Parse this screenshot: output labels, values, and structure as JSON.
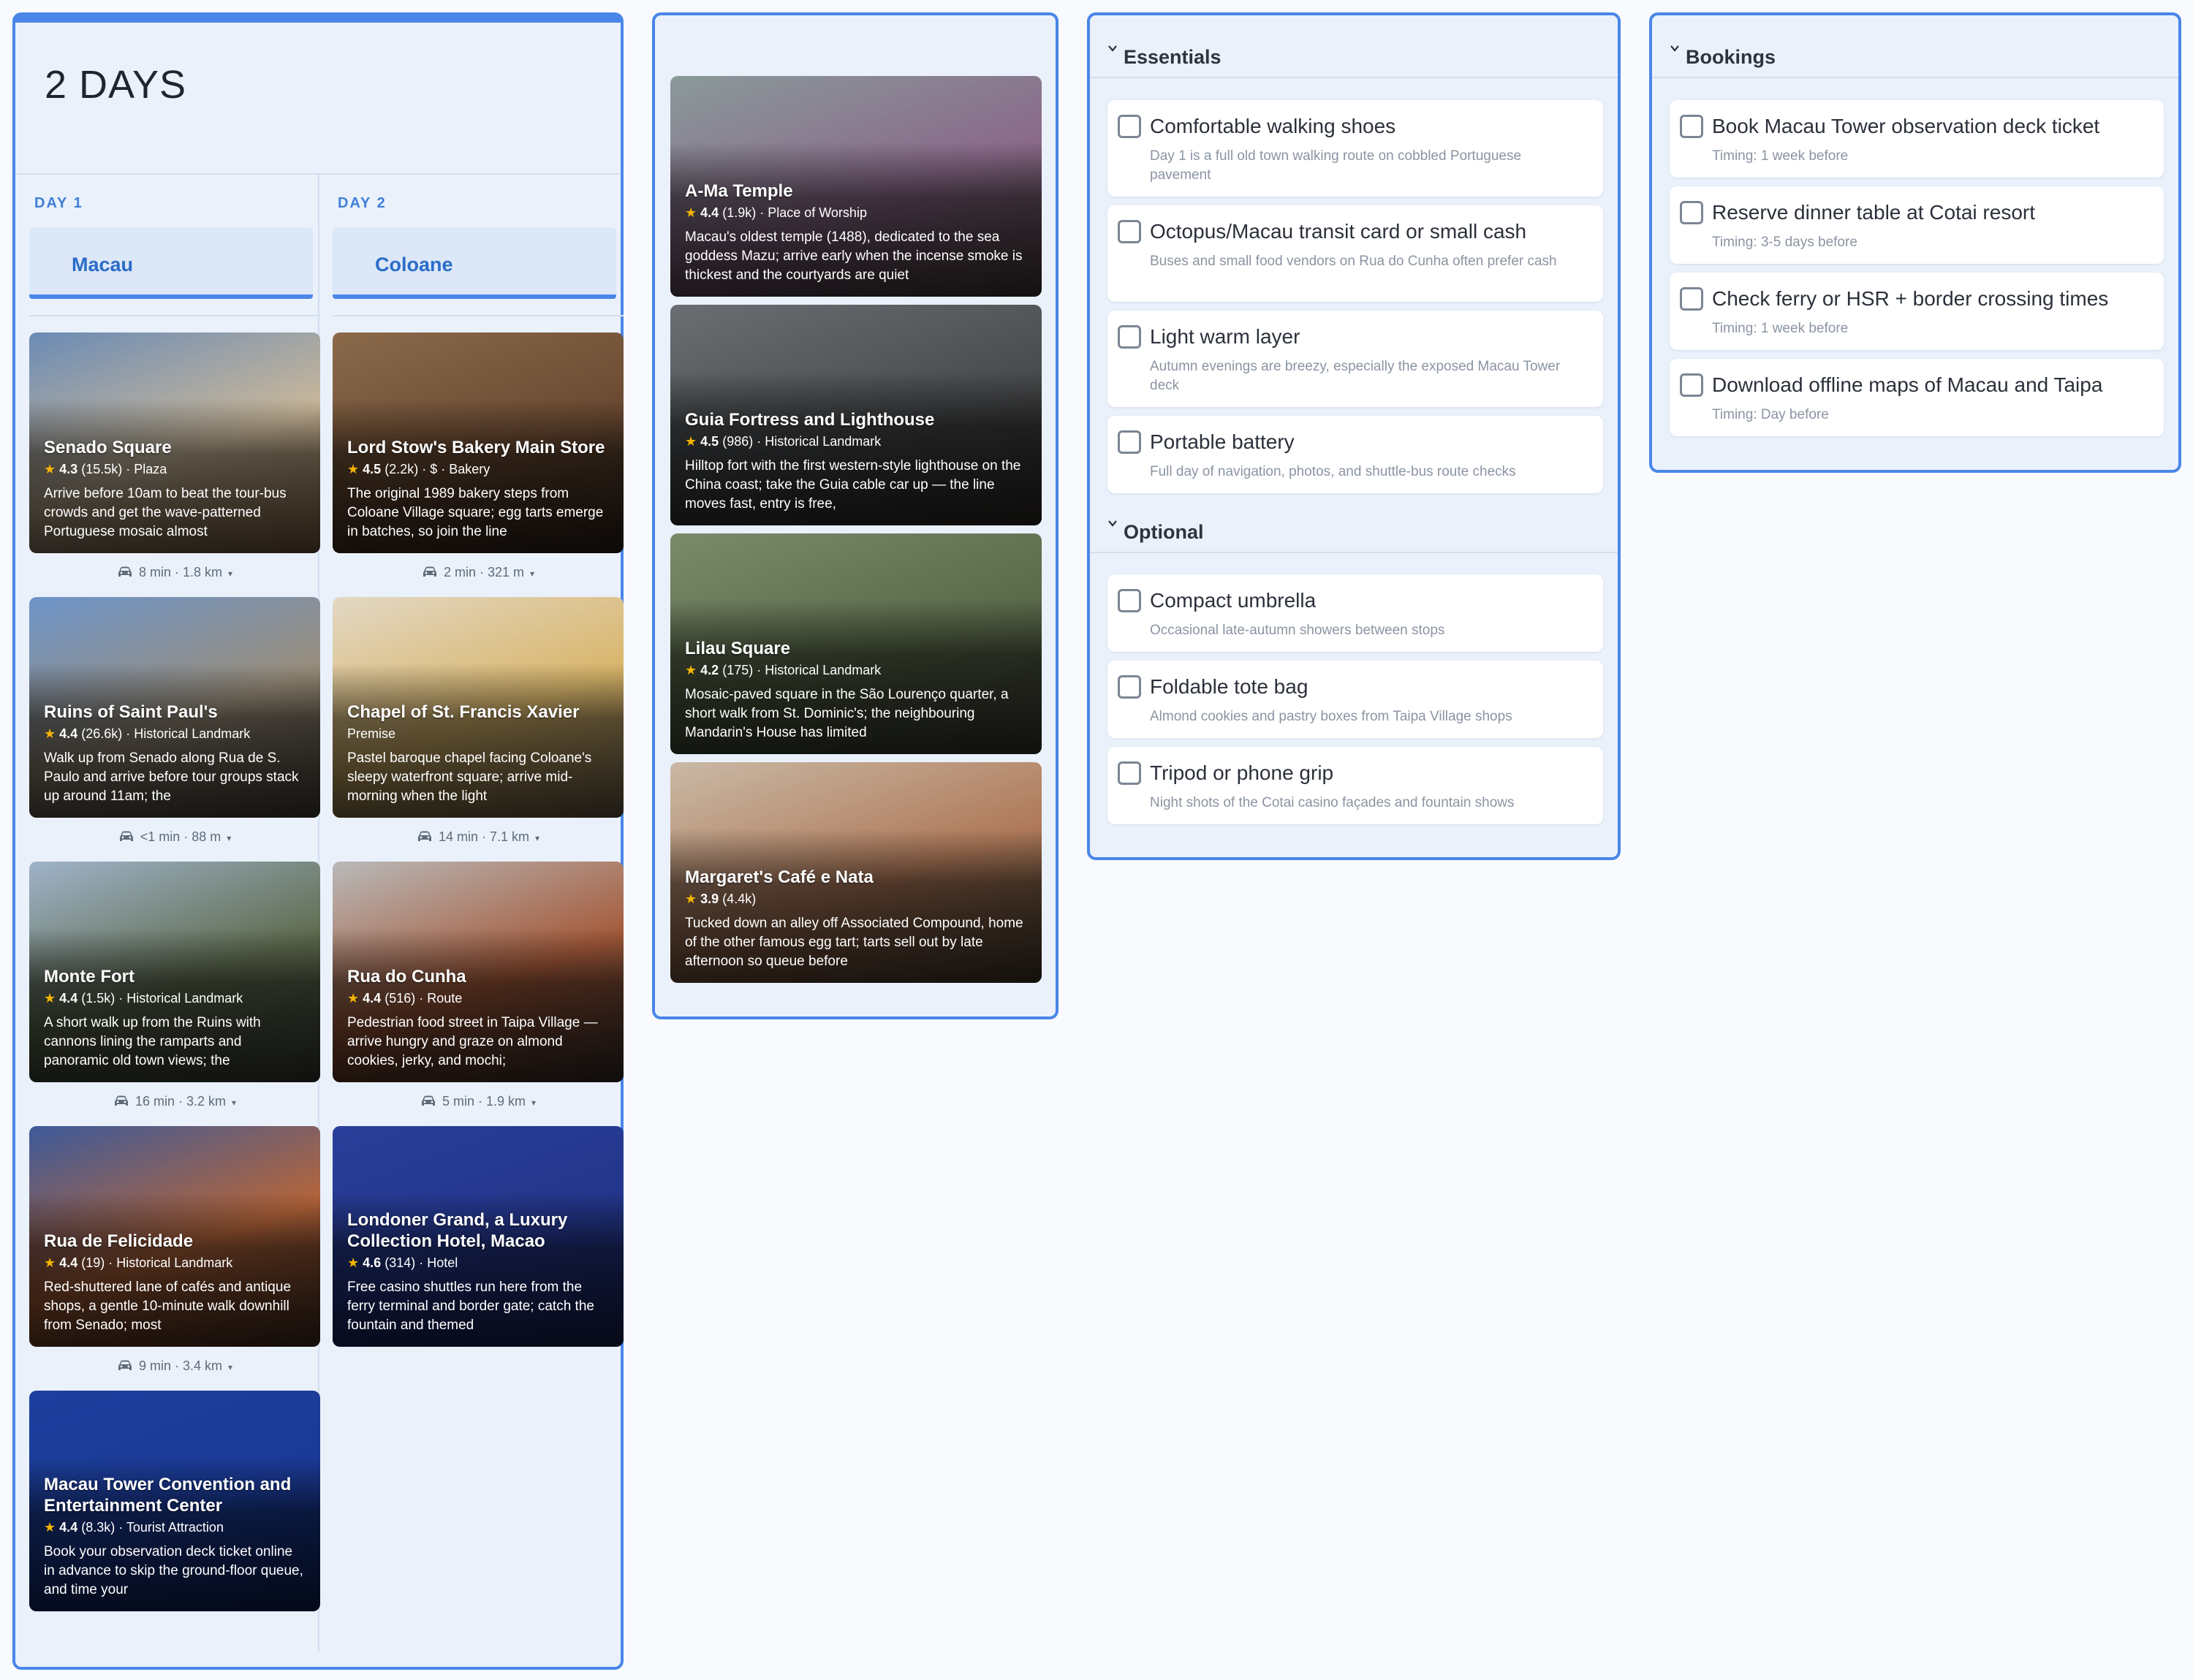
{
  "itinerary": {
    "title": "2 DAYS",
    "days": [
      {
        "label": "DAY 1",
        "location": "Macau",
        "stops": [
          {
            "name": "Senado Square",
            "rating": "4.3",
            "reviews": "(15.5k)",
            "category": "Plaza",
            "desc": "Arrive before 10am to beat the tour-bus crowds and get the wave-patterned Portuguese mosaic almost",
            "colors": [
              "#6b8bb5",
              "#c9b79a",
              "#a07a55"
            ],
            "travel": "8 min · 1.8 km"
          },
          {
            "name": "Ruins of Saint Paul's",
            "rating": "4.4",
            "reviews": "(26.6k)",
            "category": "Historical Landmark",
            "desc": "Walk up from Senado along Rua de S. Paulo and arrive before tour groups stack up around 11am; the",
            "colors": [
              "#6d94c9",
              "#9a8e7b",
              "#5d5648"
            ],
            "travel": "<1 min · 88 m"
          },
          {
            "name": "Monte Fort",
            "rating": "4.4",
            "reviews": "(1.5k)",
            "category": "Historical Landmark",
            "desc": "A short walk up from the Ruins with cannons lining the ramparts and panoramic old town views; the",
            "colors": [
              "#9fb3c9",
              "#5f6c4f",
              "#4a4f44"
            ],
            "travel": "16 min · 3.2 km"
          },
          {
            "name": "Rua de Felicidade",
            "rating": "4.4",
            "reviews": "(19)",
            "category": "Historical Landmark",
            "desc": "Red-shuttered lane of cafés and antique shops, a gentle 10-minute walk downhill from Senado; most",
            "colors": [
              "#3d5a9a",
              "#b5653a",
              "#5a3a2a"
            ],
            "travel": "9 min · 3.4 km"
          },
          {
            "name": "Macau Tower Convention and Entertainment Center",
            "rating": "4.4",
            "reviews": "(8.3k)",
            "category": "Tourist Attraction",
            "desc": "Book your observation deck ticket online in advance to skip the ground-floor queue, and time your",
            "colors": [
              "#1e3f9e",
              "#1a3a95",
              "#0f2a72"
            ],
            "travel": ""
          }
        ]
      },
      {
        "label": "DAY 2",
        "location": "Coloane",
        "stops": [
          {
            "name": "Lord Stow's Bakery Main Store",
            "rating": "4.5",
            "reviews": "(2.2k)",
            "category": "$ · Bakery",
            "desc": "The original 1989 bakery steps from Coloane Village square; egg tarts emerge in batches, so join the line",
            "colors": [
              "#8a6a4a",
              "#6b4a32",
              "#3a2a20"
            ],
            "travel": "2 min · 321 m"
          },
          {
            "name": "Chapel of St. Francis Xavier",
            "rating": "",
            "reviews": "",
            "category": "Premise",
            "desc": "Pastel baroque chapel facing Coloane's sleepy waterfront square; arrive mid-morning when the light",
            "colors": [
              "#e2d8c4",
              "#d9b56a",
              "#8b7a5c"
            ],
            "travel": "14 min · 7.1 km"
          },
          {
            "name": "Rua do Cunha",
            "rating": "4.4",
            "reviews": "(516)",
            "category": "Route",
            "desc": "Pedestrian food street in Taipa Village — arrive hungry and graze on almond cookies, jerky, and mochi;",
            "colors": [
              "#b9b9b9",
              "#a55a3a",
              "#4a3a35"
            ],
            "travel": "5 min · 1.9 km"
          },
          {
            "name": "Londoner Grand, a Luxury Collection Hotel, Macao",
            "rating": "4.6",
            "reviews": "(314)",
            "category": "Hotel",
            "desc": "Free casino shuttles run here from the ferry terminal and border gate; catch the fountain and themed",
            "colors": [
              "#2a3f9a",
              "#23358a",
              "#1c2a6a"
            ],
            "travel": ""
          }
        ]
      }
    ]
  },
  "saved_places": [
    {
      "name": "A-Ma Temple",
      "rating": "4.4",
      "reviews": "(1.9k)",
      "category": "Place of Worship",
      "desc": "Macau's oldest temple (1488), dedicated to the sea goddess Mazu; arrive early when the incense smoke is thickest and the courtyards are quiet",
      "colors": [
        "#8a9a9a",
        "#8a6a8a",
        "#5a4a4a"
      ]
    },
    {
      "name": "Guia Fortress and Lighthouse",
      "rating": "4.5",
      "reviews": "(986)",
      "category": "Historical Landmark",
      "desc": "Hilltop fort with the first western-style lighthouse on the China coast; take the Guia cable car up — the line moves fast, entry is free,",
      "colors": [
        "#6a6e72",
        "#4a4d50",
        "#3a3530"
      ]
    },
    {
      "name": "Lilau Square",
      "rating": "4.2",
      "reviews": "(175)",
      "category": "Historical Landmark",
      "desc": "Mosaic-paved square in the São Lourenço quarter, a short walk from St. Dominic's; the neighbouring Mandarin's House has limited",
      "colors": [
        "#7a8a6a",
        "#5a6a4a",
        "#4a4a40"
      ]
    },
    {
      "name": "Margaret's Café e Nata",
      "rating": "3.9",
      "reviews": "(4.4k)",
      "category": "",
      "desc": "Tucked down an alley off Associated Compound, home of the other famous egg tart; tarts sell out by late afternoon so queue before",
      "colors": [
        "#c9b9a5",
        "#b07a5a",
        "#5a4a3a"
      ]
    }
  ],
  "essentials": {
    "title": "Essentials",
    "items": [
      {
        "title": "Comfortable walking shoes",
        "sub": "Day 1 is a full old town walking route on cobbled Portuguese pavement"
      },
      {
        "title": "Octopus/Macau transit card or small cash",
        "sub": "Buses and small food vendors on Rua do Cunha often prefer cash"
      },
      {
        "title": "Light warm layer",
        "sub": "Autumn evenings are breezy, especially the exposed Macau Tower deck"
      },
      {
        "title": "Portable battery",
        "sub": "Full day of navigation, photos, and shuttle-bus route checks"
      }
    ]
  },
  "optional": {
    "title": "Optional",
    "items": [
      {
        "title": "Compact umbrella",
        "sub": "Occasional late-autumn showers between stops"
      },
      {
        "title": "Foldable tote bag",
        "sub": "Almond cookies and pastry boxes from Taipa Village shops"
      },
      {
        "title": "Tripod or phone grip",
        "sub": "Night shots of the Cotai casino façades and fountain shows"
      }
    ]
  },
  "bookings": {
    "title": "Bookings",
    "items": [
      {
        "title": "Book Macau Tower observation deck ticket",
        "sub": "Timing: 1 week before"
      },
      {
        "title": "Reserve dinner table at Cotai resort",
        "sub": "Timing: 3-5 days before"
      },
      {
        "title": "Check ferry or HSR + border crossing times",
        "sub": "Timing: 1 week before"
      },
      {
        "title": "Download offline maps of Macau and Taipa",
        "sub": "Timing: Day before"
      }
    ]
  }
}
